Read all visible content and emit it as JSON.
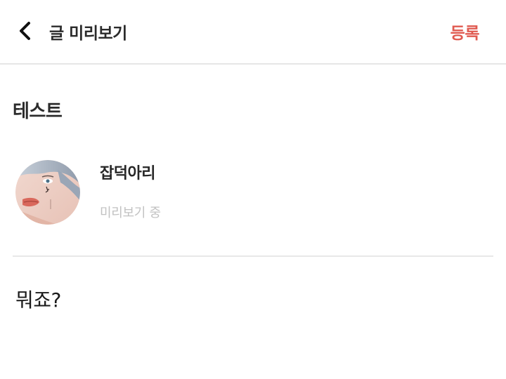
{
  "header": {
    "back_icon": "chevron-left-icon",
    "title": "글 미리보기",
    "register_label": "등록"
  },
  "post": {
    "title": "테스트",
    "author": {
      "name": "잡덕아리",
      "status": "미리보기 중",
      "avatar_icon": "avatar-photo"
    },
    "body": "뭐죠?"
  },
  "colors": {
    "accent": "#e05a50",
    "text": "#222222",
    "muted": "#c2c2c2",
    "divider": "#e6e6e6"
  }
}
